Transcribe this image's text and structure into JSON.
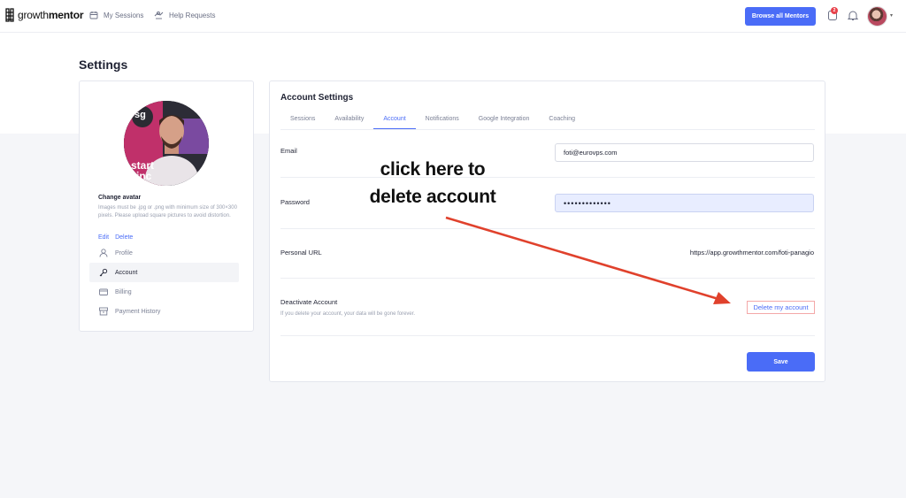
{
  "header": {
    "logo_prefix": "growth",
    "logo_suffix": "mentor",
    "nav": [
      {
        "label": "My Sessions",
        "icon": "calendar-icon"
      },
      {
        "label": "Help Requests",
        "icon": "help-hand-icon"
      }
    ],
    "browse_button": "Browse all Mentors",
    "notification_count": "2",
    "avatar_caret": "▾"
  },
  "page": {
    "title": "Settings"
  },
  "profile": {
    "change_avatar_title": "Change avatar",
    "change_avatar_help": "Images must be .jpg or .png with minimum size of 300×300 pixels. Please upload square pictures to avoid distortion.",
    "edit_link": "Edit",
    "delete_link": "Delete",
    "photo_badge_text": "sg",
    "photo_shirt_text_1": "start",
    "photo_shirt_text_2": "inc"
  },
  "sidebar": {
    "items": [
      {
        "label": "Profile",
        "icon": "user-icon",
        "active": false
      },
      {
        "label": "Account",
        "icon": "key-icon",
        "active": true
      },
      {
        "label": "Billing",
        "icon": "credit-card-icon",
        "active": false
      },
      {
        "label": "Payment History",
        "icon": "archive-icon",
        "active": false
      }
    ]
  },
  "account": {
    "title": "Account Settings",
    "tabs": [
      {
        "label": "Sessions",
        "active": false
      },
      {
        "label": "Availability",
        "active": false
      },
      {
        "label": "Account",
        "active": true
      },
      {
        "label": "Notifications",
        "active": false
      },
      {
        "label": "Google Integration",
        "active": false
      },
      {
        "label": "Coaching",
        "active": false
      }
    ],
    "email_label": "Email",
    "email_value": "foti@eurovps.com",
    "password_label": "Password",
    "password_value": "•••••••••••••",
    "url_label": "Personal URL",
    "url_value": "https://app.growthmentor.com/foti-panagio",
    "deactivate_title": "Deactivate Account",
    "deactivate_subtitle": "If you delete your account, your data will be gone forever.",
    "delete_account_link": "Delete my account",
    "save_button": "Save"
  },
  "annotation": {
    "line1": "click here to",
    "line2": "delete account",
    "arrow_color": "#e0412c"
  },
  "colors": {
    "accent": "#4a6cf7",
    "badge": "#e8414a"
  }
}
